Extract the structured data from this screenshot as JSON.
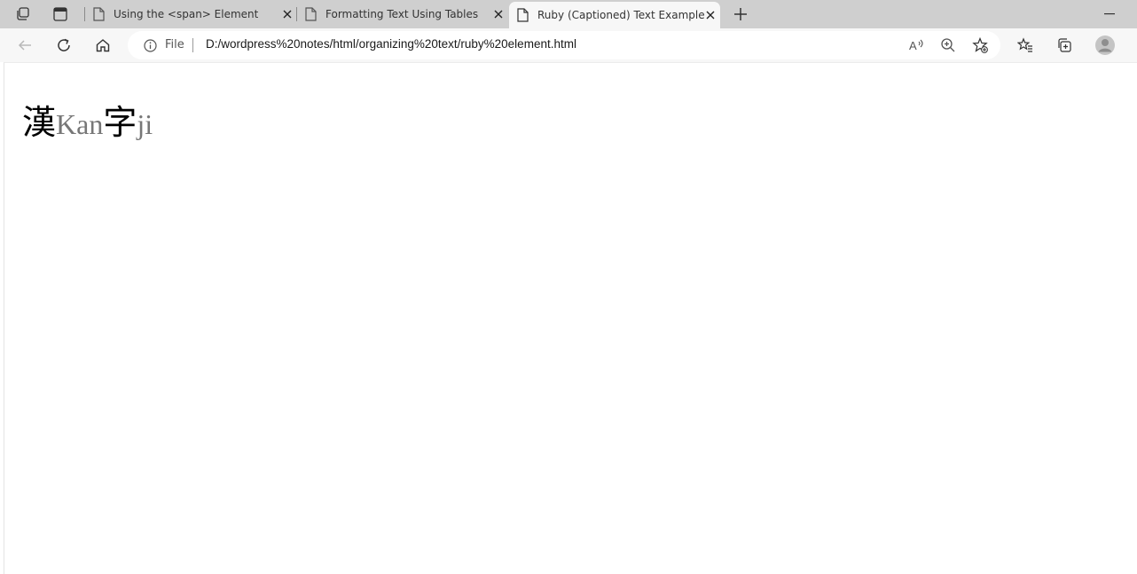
{
  "browser": {
    "tabs": [
      {
        "title": "Using the <span> Element",
        "active": false
      },
      {
        "title": "Formatting Text Using Tables",
        "active": false
      },
      {
        "title": "Ruby (Captioned) Text Example",
        "active": true
      }
    ],
    "address": {
      "scheme_label": "File",
      "url": "D:/wordpress%20notes/html/organizing%20text/ruby%20element.html"
    },
    "icons": {
      "workspaces": "workspaces-icon",
      "tab_actions": "tab-actions-icon",
      "back": "back-arrow-icon",
      "refresh": "refresh-icon",
      "home": "home-icon",
      "info": "info-icon",
      "read_aloud": "read-aloud-icon",
      "zoom": "zoom-icon",
      "add_favorite": "add-favorite-icon",
      "favorites": "favorites-icon",
      "collections": "collections-icon",
      "profile": "profile-avatar"
    }
  },
  "page": {
    "ruby": [
      {
        "base": "漢",
        "annotation": "Kan"
      },
      {
        "base": "字",
        "annotation": "ji"
      }
    ]
  },
  "colors": {
    "tabbar_bg": "#cfcfcf",
    "toolbar_bg": "#f7f7f7",
    "ruby_text": "#777777"
  }
}
